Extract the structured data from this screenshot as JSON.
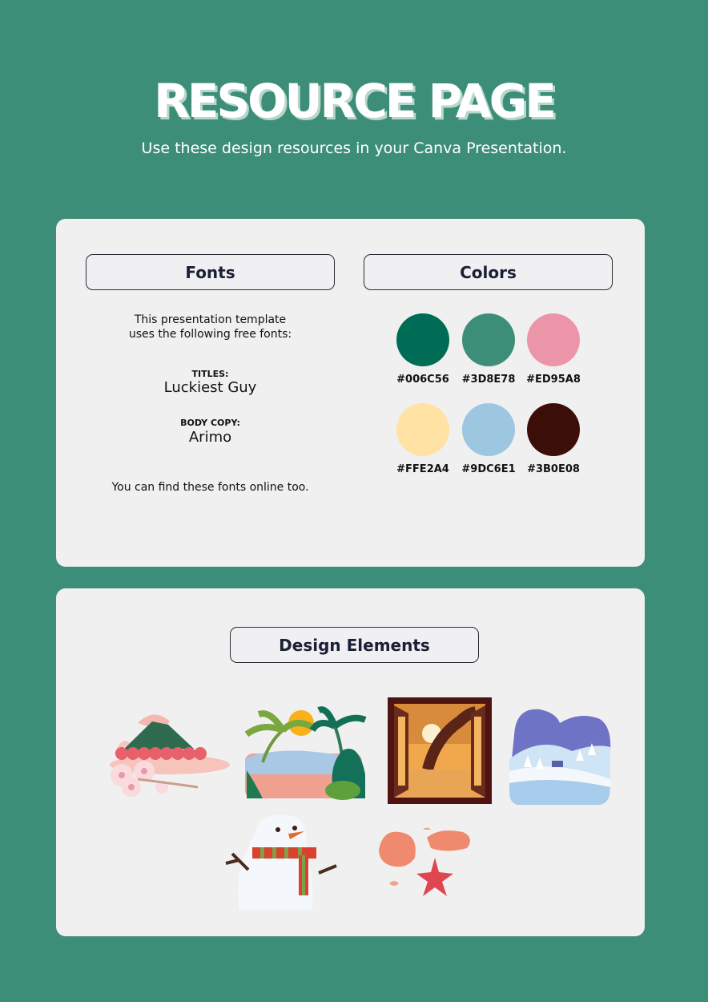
{
  "header": {
    "title": "RESOURCE PAGE",
    "subtitle": "Use these design resources in your Canva Presentation."
  },
  "fonts_section": {
    "heading": "Fonts",
    "intro_line1": "This presentation template",
    "intro_line2": "uses the following free fonts:",
    "titles_label": "TITLES:",
    "titles_font": "Luckiest Guy",
    "body_label": "BODY COPY:",
    "body_font": "Arimo",
    "footer": "You can find these fonts online too."
  },
  "colors_section": {
    "heading": "Colors",
    "swatches": [
      {
        "hex": "#006C56",
        "color": "#006c56"
      },
      {
        "hex": "#3D8E78",
        "color": "#3d8e78"
      },
      {
        "hex": "#ED95A8",
        "color": "#ed95a8"
      },
      {
        "hex": "#FFE2A4",
        "color": "#ffe2a4"
      },
      {
        "hex": "#9DC6E1",
        "color": "#9dc6e1"
      },
      {
        "hex": "#3B0E08",
        "color": "#3b0e08"
      }
    ]
  },
  "design_elements": {
    "heading": "Design Elements",
    "items": [
      {
        "name": "mountain-cherry-blossom-illustration"
      },
      {
        "name": "tropical-beach-illustration"
      },
      {
        "name": "autumn-window-illustration"
      },
      {
        "name": "winter-landscape-illustration"
      },
      {
        "name": "snowman-illustration"
      },
      {
        "name": "seashells-starfish-illustration"
      }
    ]
  }
}
